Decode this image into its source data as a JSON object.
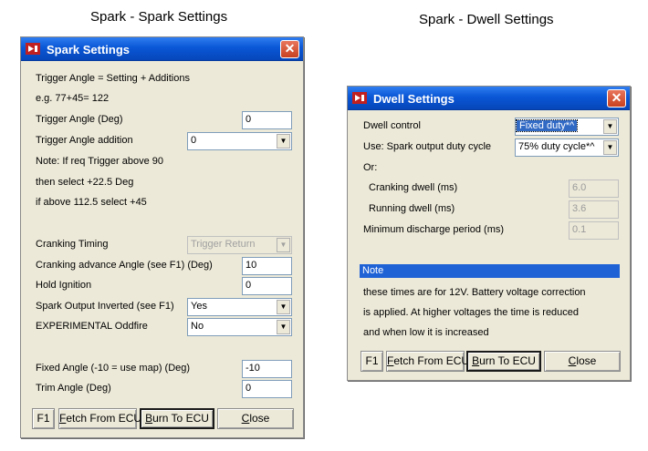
{
  "captions": {
    "spark": "Spark - Spark Settings",
    "dwell": "Spark - Dwell Settings"
  },
  "spark_window": {
    "title": "Spark Settings",
    "close_glyph": "✕",
    "info1": "Trigger Angle = Setting + Additions",
    "info2": "e.g. 77+45= 122",
    "trigger_angle_label": "Trigger Angle  (Deg)",
    "trigger_angle_value": "0",
    "trigger_addition_label": "Trigger Angle addition",
    "trigger_addition_value": "0",
    "note1": "Note: If req Trigger above 90",
    "note2": "then select +22.5 Deg",
    "note3": "if above 112.5 select +45",
    "cranking_timing_label": "Cranking Timing",
    "cranking_timing_value": "Trigger Return",
    "cranking_advance_label": "Cranking advance Angle (see F1) (Deg)",
    "cranking_advance_value": "10",
    "hold_ignition_label": "Hold Ignition",
    "hold_ignition_value": "0",
    "spark_inverted_label": "Spark Output Inverted (see F1)",
    "spark_inverted_value": "Yes",
    "oddfire_label": "EXPERIMENTAL Oddfire",
    "oddfire_value": "No",
    "fixed_angle_label": "Fixed Angle (-10 = use map) (Deg)",
    "fixed_angle_value": "-10",
    "trim_angle_label": "Trim Angle (Deg)",
    "trim_angle_value": "0",
    "buttons": {
      "f1": "F1",
      "fetch_first": "F",
      "fetch_rest": "etch From ECU",
      "burn_first": "B",
      "burn_rest": "urn To ECU",
      "close_first": "C",
      "close_rest": "lose"
    }
  },
  "dwell_window": {
    "title": "Dwell Settings",
    "close_glyph": "✕",
    "dwell_control_label": "Dwell control",
    "dwell_control_value": "Fixed duty*^",
    "use_spark_label": "Use: Spark output duty cycle",
    "use_spark_value": "75% duty cycle*^",
    "or_label": "Or:",
    "cranking_dwell_label": "Cranking dwell (ms)",
    "cranking_dwell_value": "6.0",
    "running_dwell_label": "Running dwell (ms)",
    "running_dwell_value": "3.6",
    "min_discharge_label": "Minimum discharge period (ms)",
    "min_discharge_value": "0.1",
    "note_header": "Note",
    "note1": "these times are for 12V. Battery voltage correction",
    "note2": "is applied. At higher voltages the time is reduced",
    "note3": "and when low it is increased",
    "buttons": {
      "f1": "F1",
      "fetch_first": "F",
      "fetch_rest": "etch From ECU",
      "burn_first": "B",
      "burn_rest": "urn To ECU",
      "close_first": "C",
      "close_rest": "lose"
    }
  },
  "icons": {
    "dropdown_arrow": "▼"
  },
  "colors": {
    "titlebar": "#0a57d6",
    "window_bg": "#ece9d8",
    "note_bar": "#1f62d6",
    "close_button": "#c8401f"
  }
}
